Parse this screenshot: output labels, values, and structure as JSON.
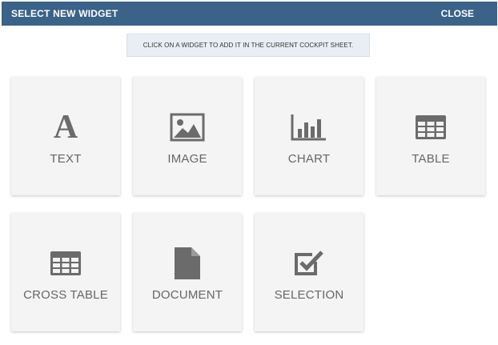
{
  "header": {
    "title": "SELECT NEW WIDGET",
    "close_label": "CLOSE",
    "color": "#3b6288"
  },
  "hint": {
    "text": "CLICK ON A WIDGET TO ADD IT IN THE CURRENT COCKPIT SHEET."
  },
  "widgets": [
    {
      "label": "TEXT",
      "icon": "text-a-icon",
      "glyph": "A"
    },
    {
      "label": "IMAGE",
      "icon": "image-icon"
    },
    {
      "label": "CHART",
      "icon": "bar-chart-icon"
    },
    {
      "label": "TABLE",
      "icon": "table-icon"
    },
    {
      "label": "CROSS TABLE",
      "icon": "cross-table-icon"
    },
    {
      "label": "DOCUMENT",
      "icon": "document-icon"
    },
    {
      "label": "SELECTION",
      "icon": "checkbox-icon"
    }
  ]
}
